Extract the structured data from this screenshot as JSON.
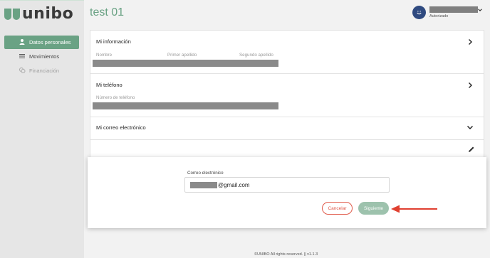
{
  "brand": {
    "name": "unibo",
    "accent": "#6aa284"
  },
  "sidebar": {
    "items": [
      {
        "label": "Datos personales",
        "icon": "person-icon",
        "state": "active"
      },
      {
        "label": "Movimientos",
        "icon": "list-icon",
        "state": "normal"
      },
      {
        "label": "Financiación",
        "icon": "coins-icon",
        "state": "disabled"
      }
    ]
  },
  "header": {
    "title": "test 01",
    "user_status": "Autorizado"
  },
  "sections": {
    "info": {
      "title": "Mi información",
      "fields": [
        "Nombre",
        "Primer apellido",
        "Segundo apellido"
      ]
    },
    "phone": {
      "title": "Mi teléfono",
      "fields": [
        "Número de teléfono"
      ]
    },
    "email": {
      "title": "Mi correo electrónico"
    }
  },
  "form": {
    "email_label": "Correo electrónico",
    "email_value_visible": "@gmail.com",
    "cancel_label": "Cancelar",
    "next_label": "Siguiente"
  },
  "footer": {
    "text": "©UNIBO All rights reserved. || v1.1.3"
  },
  "colors": {
    "cancel": "#e05a4a",
    "next": "#9dc2ad",
    "arrow": "#e04030"
  }
}
